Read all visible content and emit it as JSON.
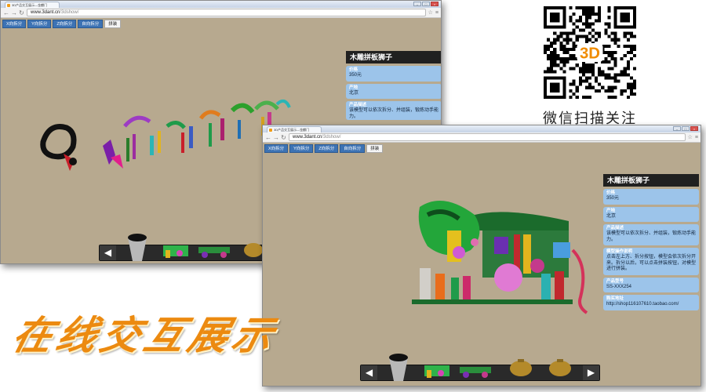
{
  "window_back": {
    "tab_title": "3D产品交互展示—金麒门",
    "url_host": "www.3dant.cn",
    "url_path": "/3dshow/",
    "buttons": [
      "X向拆分",
      "Y向拆分",
      "Z向拆分",
      "自向拆分",
      "拼装"
    ],
    "panel": {
      "title": "木雕拼板狮子",
      "fields": [
        {
          "label": "价格",
          "value": "350元"
        },
        {
          "label": "产地",
          "value": "北京"
        },
        {
          "label": "产品描述",
          "value": "该模型可以依次拆分、并组装，锻炼动手能力。"
        }
      ]
    }
  },
  "window_front": {
    "tab_title": "3D产品交互展示—金麒门",
    "url_host": "www.3dant.cn",
    "url_path": "/3dshow/",
    "buttons": [
      "X向拆分",
      "Y向拆分",
      "Z向拆分",
      "自向拆分",
      "拼装"
    ],
    "panel": {
      "title": "木雕拼板狮子",
      "fields": [
        {
          "label": "价格",
          "value": "350元"
        },
        {
          "label": "产地",
          "value": "北京"
        },
        {
          "label": "产品描述",
          "value": "该模型可以依次拆分、并组装，锻炼动手能力。"
        },
        {
          "label": "模型操作说明",
          "value": "点击左上方、拆分按钮，模型会依次拆分开来。拆分以后，可以点击拼装按钮，对模型进行拼装。"
        },
        {
          "label": "产品型号",
          "value": "SS-XXX254"
        },
        {
          "label": "购买地址",
          "value": "http://shop116107610.taobao.com/"
        }
      ]
    }
  },
  "qr_center_label": "3D",
  "wechat_caption": "微信扫描关注",
  "slogan": "在线交互展示",
  "colors": {
    "accent_orange": "#ec8a10",
    "button_blue": "#3d73b4",
    "panel_blue": "#9cc4ea",
    "canvas_bg": "#b7a98f"
  },
  "icons": [
    "back-arrow-icon",
    "forward-arrow-icon",
    "reload-icon",
    "star-icon",
    "menu-icon",
    "prev-arrow-icon",
    "next-arrow-icon"
  ]
}
